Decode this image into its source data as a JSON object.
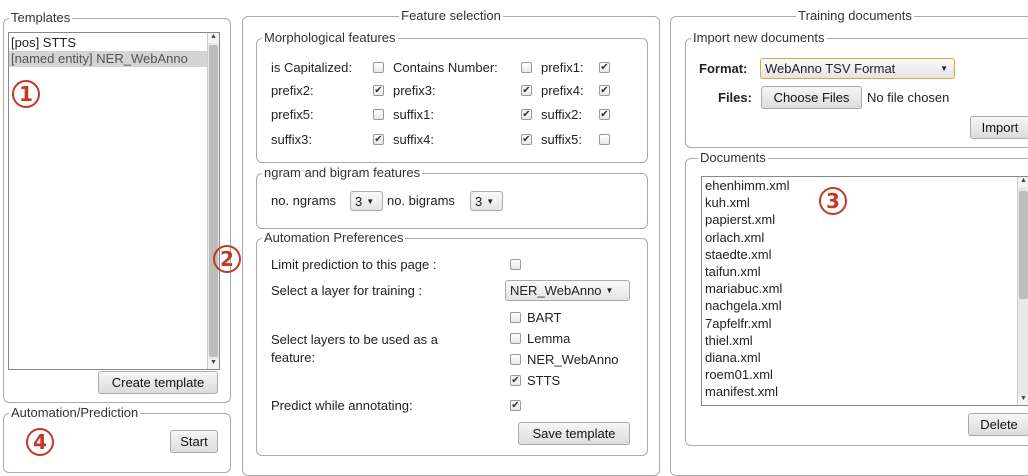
{
  "templates": {
    "legend": "Templates",
    "items": [
      "[pos] STTS",
      "[named entity] NER_WebAnno"
    ],
    "create_label": "Create template",
    "badge": "1"
  },
  "automation": {
    "legend": "Automation/Prediction",
    "start_label": "Start",
    "badge": "4"
  },
  "feature": {
    "legend": "Feature selection",
    "badge": "2",
    "morph": {
      "legend": "Morphological features",
      "labels": [
        "is Capitalized:",
        "Contains Number:",
        "prefix1:",
        "prefix2:",
        "prefix3:",
        "prefix4:",
        "prefix5:",
        "suffix1:",
        "suffix2:",
        "suffix3:",
        "suffix4:",
        "suffix5:"
      ],
      "checked": [
        false,
        false,
        true,
        true,
        true,
        true,
        false,
        true,
        true,
        true,
        true,
        false
      ]
    },
    "ngram": {
      "legend": "ngram and bigram features",
      "ngrams_label": "no. ngrams",
      "ngrams_value": "3",
      "bigrams_label": "no. bigrams",
      "bigrams_value": "3"
    },
    "prefs": {
      "legend": "Automation Preferences",
      "limit_label": "Limit prediction to this page :",
      "layer_label": "Select a layer for training :",
      "layer_value": "NER_WebAnno",
      "feature_layers_label": "Select layers to be used as a feature:",
      "feature_layers": [
        {
          "label": "BART",
          "checked": false
        },
        {
          "label": "Lemma",
          "checked": false
        },
        {
          "label": "NER_WebAnno",
          "checked": false
        },
        {
          "label": "STTS",
          "checked": true
        }
      ],
      "predict_label": "Predict while annotating:",
      "predict_checked": true,
      "save_label": "Save template"
    }
  },
  "training": {
    "legend": "Training documents",
    "import": {
      "legend": "Import new documents",
      "format_label": "Format:",
      "format_value": "WebAnno TSV Format",
      "files_label": "Files:",
      "choose_label": "Choose Files",
      "no_file": "No file chosen",
      "import_label": "Import"
    },
    "documents": {
      "legend": "Documents",
      "files": [
        "ehenhimm.xml",
        "kuh.xml",
        "papierst.xml",
        "orlach.xml",
        "staedte.xml",
        "taifun.xml",
        "mariabuc.xml",
        "nachgela.xml",
        "7apfelfr.xml",
        "thiel.xml",
        "diana.xml",
        "roem01.xml",
        "manifest.xml"
      ],
      "delete_label": "Delete",
      "badge": "3"
    }
  },
  "colors": {
    "badge": "#c0392b",
    "select_highlight": "#e8a33d"
  }
}
